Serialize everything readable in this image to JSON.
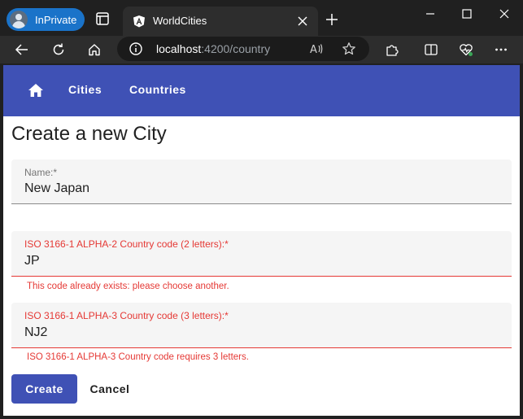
{
  "browser": {
    "inprivate_label": "InPrivate",
    "tab_title": "WorldCities",
    "url_host": "localhost",
    "url_path": ":4200/country"
  },
  "app": {
    "nav": {
      "cities_label": "Cities",
      "countries_label": "Countries"
    },
    "page_title": "Create a new City",
    "form": {
      "name": {
        "label": "Name:*",
        "value": "New Japan"
      },
      "iso2": {
        "label": "ISO 3166-1 ALPHA-2 Country code (2 letters):*",
        "value": "JP",
        "error": "This code already exists: please choose another."
      },
      "iso3": {
        "label": "ISO 3166-1 ALPHA-3 Country code (3 letters):*",
        "value": "NJ2",
        "error": "ISO 3166-1 ALPHA-3 Country code requires 3 letters."
      }
    },
    "create_label": "Create",
    "cancel_label": "Cancel"
  },
  "colors": {
    "primary": "#3f51b5",
    "error": "#e53935",
    "inprivate": "#1a73c9"
  },
  "icons": [
    "profile-avatar-icon",
    "tab-actions-icon",
    "angular-favicon-icon",
    "close-icon",
    "new-tab-icon",
    "minimize-icon",
    "maximize-icon",
    "window-close-icon",
    "back-icon",
    "refresh-icon",
    "browser-home-icon",
    "info-icon",
    "read-aloud-icon",
    "favorite-star-icon",
    "extensions-icon",
    "split-screen-icon",
    "browser-essentials-icon",
    "home-icon"
  ]
}
